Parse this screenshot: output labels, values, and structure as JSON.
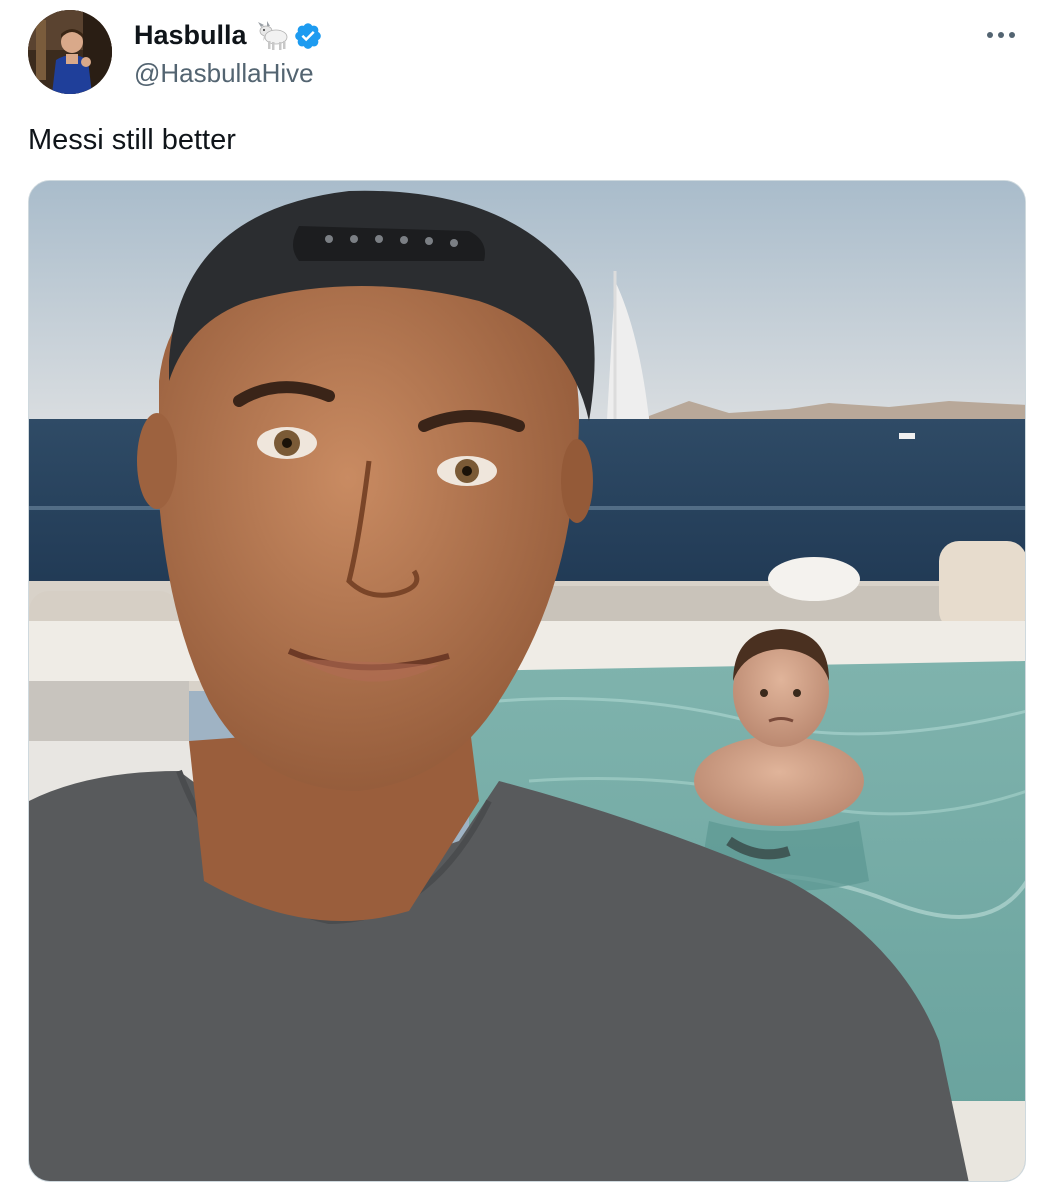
{
  "tweet": {
    "author": {
      "display_name": "Hasbulla",
      "handle": "@HasbullaHive",
      "emoji_icon": "goat-icon",
      "verified_icon": "verified-badge-icon",
      "verified_color": "#1d9bf0"
    },
    "text": "Messi still better",
    "more_icon": "more-horizontal-icon",
    "media": {
      "type": "photo",
      "alt_icon": "photo-selfie"
    }
  },
  "colors": {
    "name": "#0f1419",
    "handle": "#536471",
    "verified": "#1d9bf0",
    "border": "#cfd9de"
  }
}
